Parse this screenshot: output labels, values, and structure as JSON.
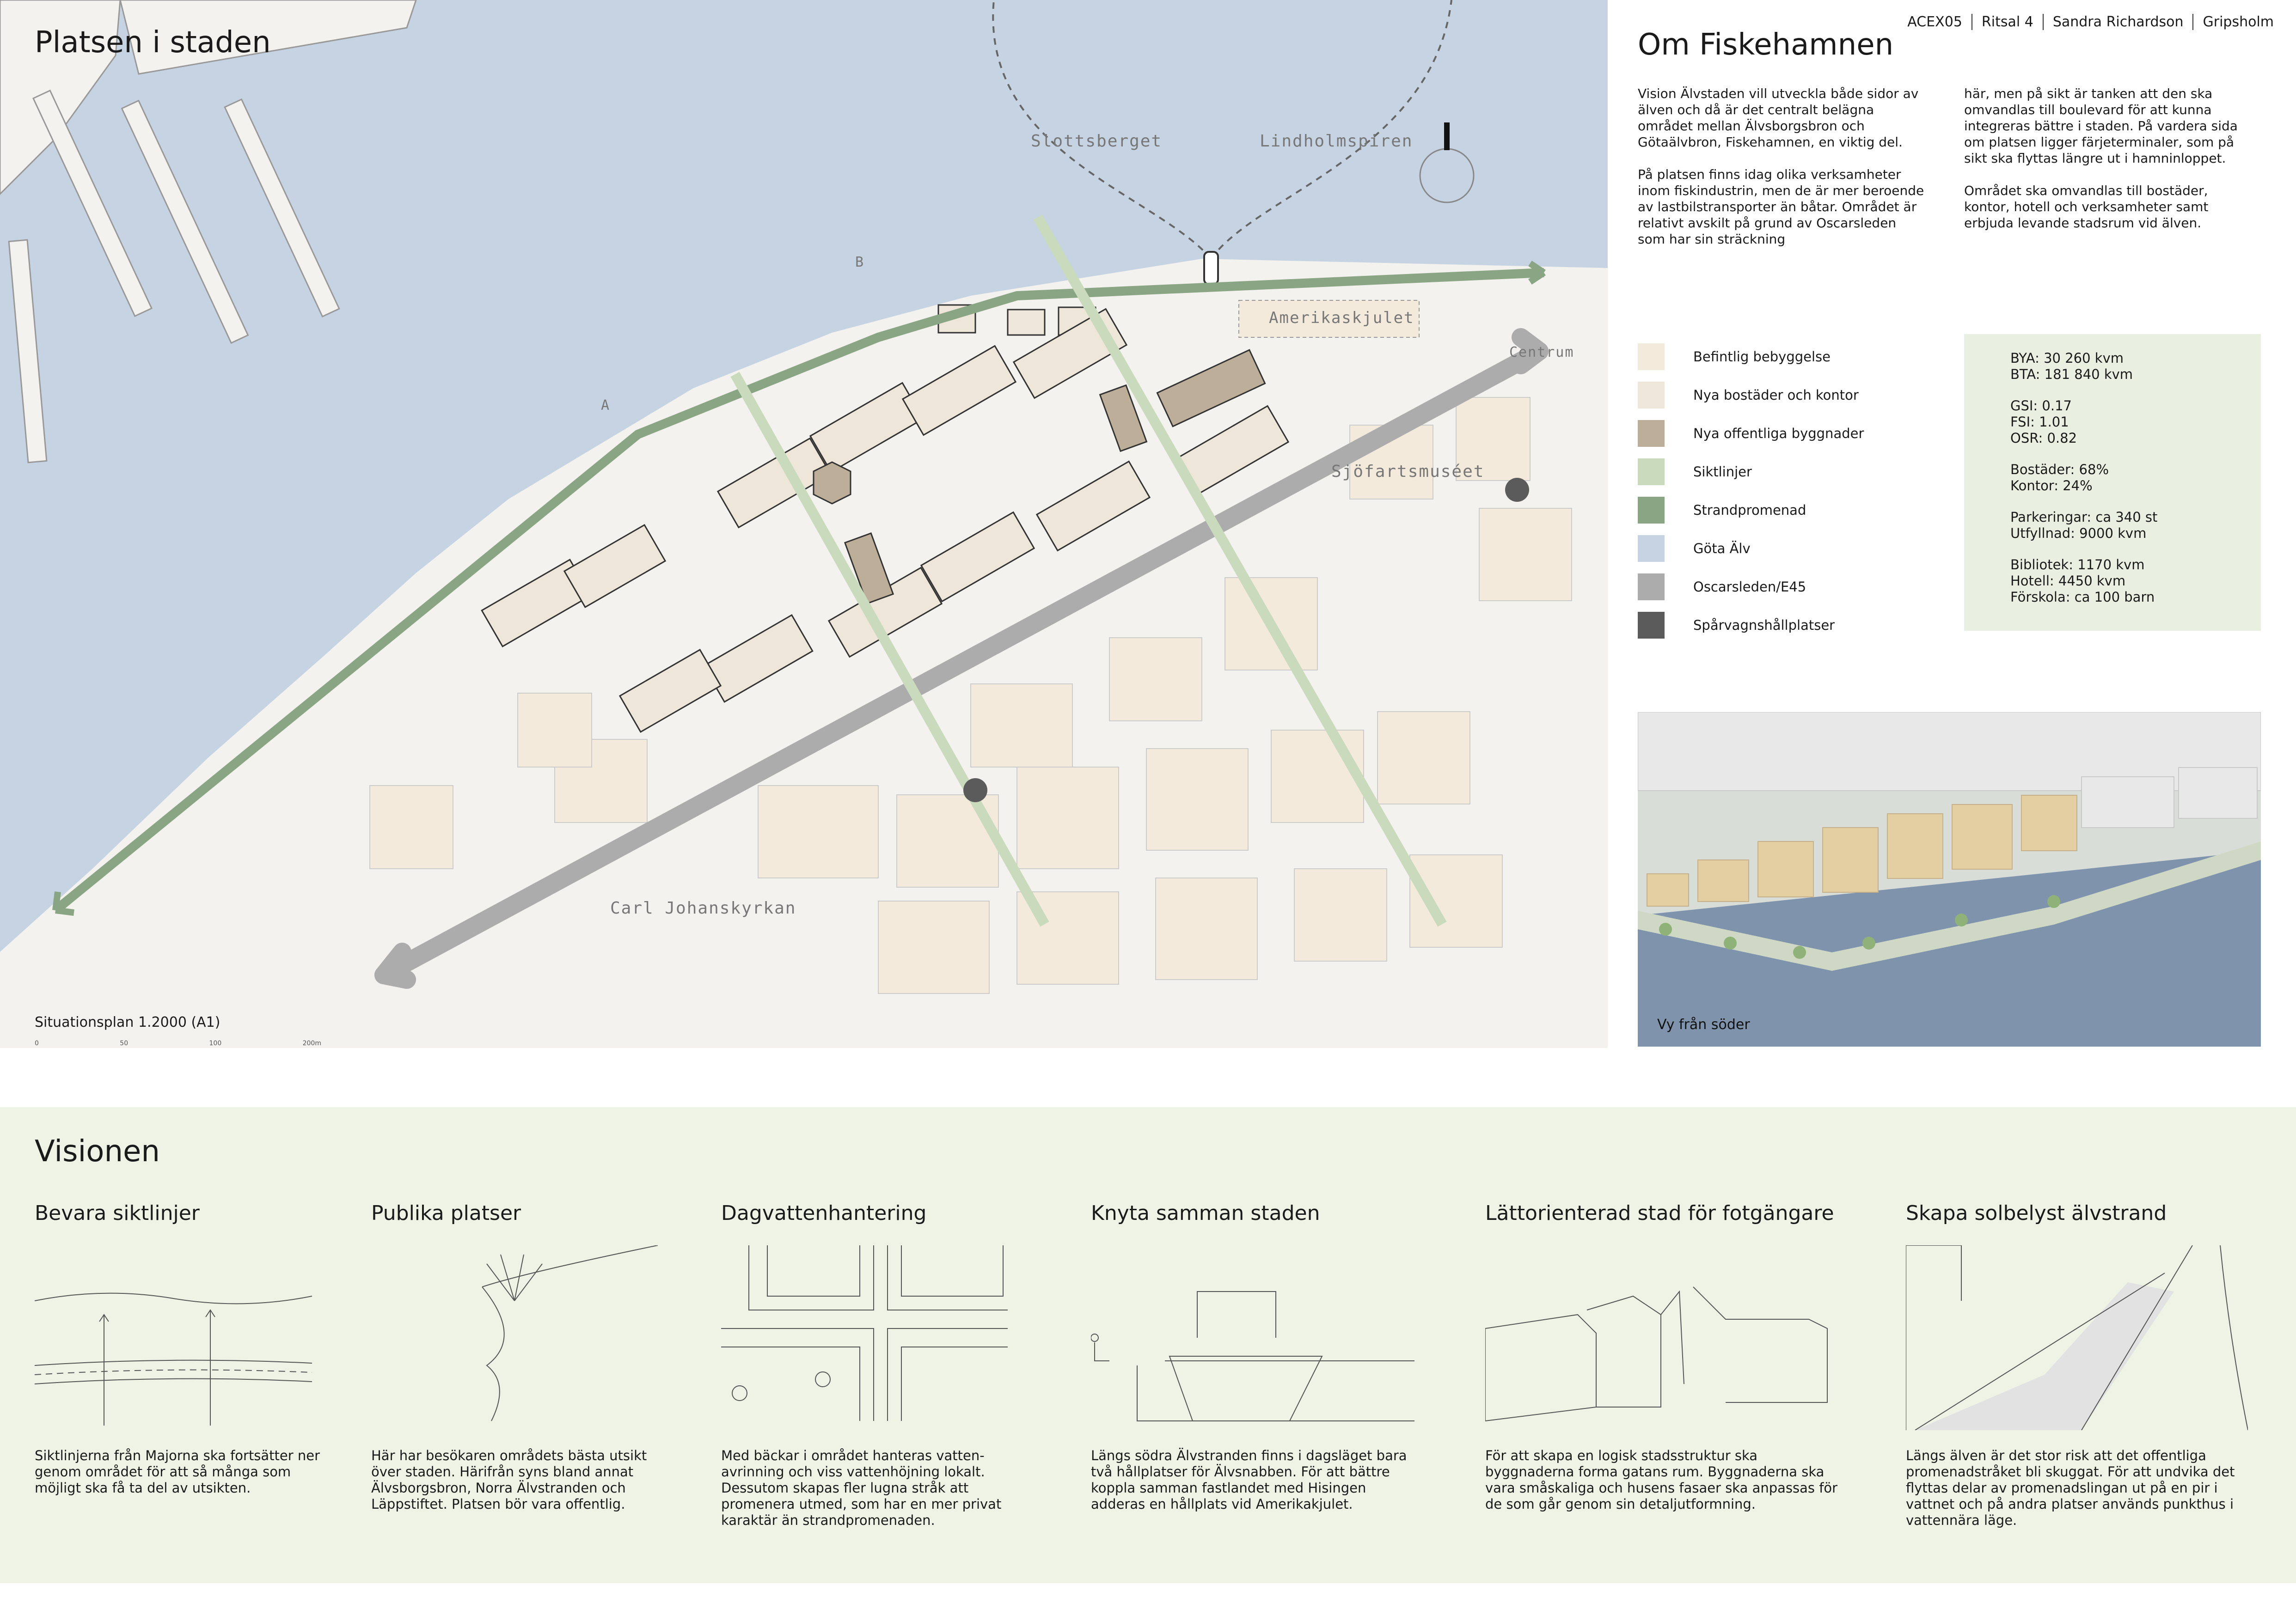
{
  "header": {
    "course": "ACEX05",
    "sheet": "Ritsal 4",
    "author": "Sandra Richardson",
    "studio": "Gripsholm"
  },
  "map": {
    "title": "Platsen i staden",
    "caption": "Situationsplan 1.2000 (A1)",
    "scale_ticks": [
      "0",
      "50",
      "100",
      "200m"
    ],
    "labels": {
      "stolsberget": "Slottsberget",
      "lindholmspiren": "Lindholmspiren",
      "amerikaskjulet": "Amerikaskjulet",
      "centrum": "Centrum",
      "sjofartsmuseet": "Sjöfartsmuséet",
      "carl_johans": "Carl Johanskyrkan",
      "section_a": "A",
      "section_b": "B"
    }
  },
  "intro": {
    "title": "Om Fiskehamnen",
    "col1": [
      "Vision Älvstaden vill utveckla både sidor av älven och då är det centralt belägna området mellan Älvsborgsbron och Götaälvbron, Fiskehamnen, en viktig del.",
      "På platsen finns idag olika verksamheter inom fiskindustrin, men de är mer beroende av lastbilstransporter än båtar. Området är relativt avskilt på grund av Oscarsleden som har sin sträckning"
    ],
    "col2": [
      "här, men på sikt är tanken att den ska omvandlas till boulevard för att kunna integreras bättre i staden. På vardera sida om platsen ligger färjeterminaler, som på sikt ska flyttas längre ut i hamninloppet.",
      "Området ska omvandlas till bostäder, kontor, hotell och verksamheter samt erbjuda levande stadsrum vid älven."
    ]
  },
  "legend": [
    {
      "label": "Befintlig bebyggelse",
      "color": "#f3eadc"
    },
    {
      "label": "Nya bostäder och kontor",
      "color": "#eee6d9"
    },
    {
      "label": "Nya offentliga byggnader",
      "color": "#bcae98"
    },
    {
      "label": "Siktlinjer",
      "color": "#c9dabd"
    },
    {
      "label": "Strandpromenad",
      "color": "#8aa584"
    },
    {
      "label": "Göta Älv",
      "color": "#c6d3e3"
    },
    {
      "label": "Oscarsleden/E45",
      "color": "#acacac"
    },
    {
      "label": "Spårvagnshållplatser",
      "color": "#5b5b5b"
    }
  ],
  "stats": [
    [
      "BYA: 30 260 kvm",
      "BTA: 181 840 kvm"
    ],
    [
      "GSI: 0.17",
      "FSI: 1.01",
      "OSR: 0.82"
    ],
    [
      "Bostäder: 68%",
      "Kontor: 24%"
    ],
    [
      "Parkeringar: ca 340 st",
      "Utfyllnad: 9000 kvm"
    ],
    [
      "Bibliotek: 1170 kvm",
      "Hotell: 4450 kvm",
      "Förskola: ca 100 barn"
    ]
  ],
  "render": {
    "caption": "Vy från söder"
  },
  "vision": {
    "title": "Visionen",
    "items": [
      {
        "title": "Bevara siktlinjer",
        "text": "Siktlinjerna från Majorna ska fortsätter ner genom området för att så många som möjligt ska få ta del av utsikten."
      },
      {
        "title": "Publika platser",
        "text": "Här har besökaren områdets bästa utsikt över staden. Härifrån syns bland annat Älvsborgsbron, Norra Älvstranden och Läppstiftet. Platsen bör vara offentlig."
      },
      {
        "title": "Dagvattenhantering",
        "text": "Med bäckar i området hanteras vatten-avrinning och viss vattenhöjning lokalt. Dessutom skapas fler lugna stråk att promenera utmed, som har en mer privat karaktär än strandpromenaden."
      },
      {
        "title": "Knyta samman staden",
        "text": "Längs södra Älvstranden finns i dagsläget bara två hållplatser för Älvsnabben. För att bättre koppla samman fastlandet med Hisingen adderas en hållplats vid Amerikakjulet."
      },
      {
        "title": "Lättorienterad stad för fotgängare",
        "text": "För att skapa en logisk stadsstruktur ska byggnaderna forma gatans rum. Byggnaderna ska vara småskaliga och husens fasaer ska anpassas för de som går genom sin detaljutformning."
      },
      {
        "title": "Skapa solbelyst älvstrand",
        "text": "Längs älven är det stor risk att det offentliga promenadstråket bli skuggat. För att undvika det flyttas delar av promenadslingan ut på en pir i vattnet och på andra platser används punkthus i vattennära läge."
      }
    ]
  }
}
